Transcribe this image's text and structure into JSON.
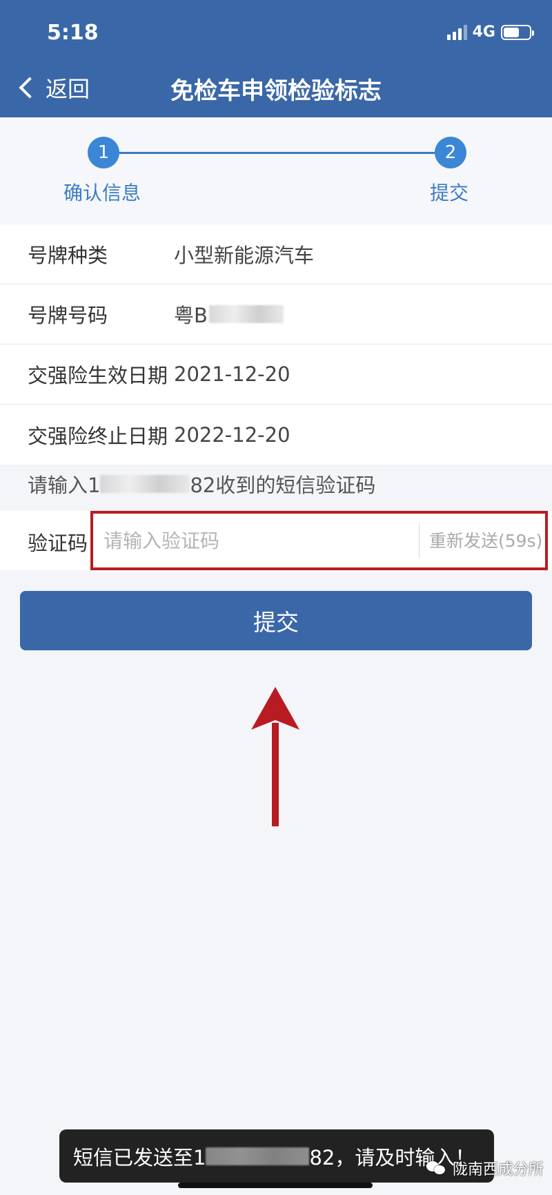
{
  "status_bar": {
    "time": "5:18",
    "network": "4G"
  },
  "nav": {
    "back_label": "返回",
    "title": "免检车申领检验标志"
  },
  "steps": [
    {
      "number": "1",
      "label": "确认信息"
    },
    {
      "number": "2",
      "label": "提交"
    }
  ],
  "info_rows": [
    {
      "label": "号牌种类",
      "value": "小型新能源汽车"
    },
    {
      "label": "号牌号码",
      "value": "粤B"
    },
    {
      "label": "交强险生效日期",
      "value": "2021-12-20"
    },
    {
      "label": "交强险终止日期",
      "value": "2022-12-20"
    }
  ],
  "sms_hint": {
    "prefix": "请输入1",
    "suffix": "82收到的短信验证码"
  },
  "verification": {
    "label": "验证码",
    "placeholder": "请输入验证码",
    "resend_label": "重新发送(59s)"
  },
  "submit_label": "提交",
  "toast": {
    "prefix": "短信已发送至1",
    "suffix": "82，请及时输入！"
  },
  "watermark": "陇南西成分所",
  "colors": {
    "header": "#3a67a8",
    "step_accent": "#3b87d6",
    "highlight_box": "#b81c22",
    "arrow": "#b81c22"
  }
}
